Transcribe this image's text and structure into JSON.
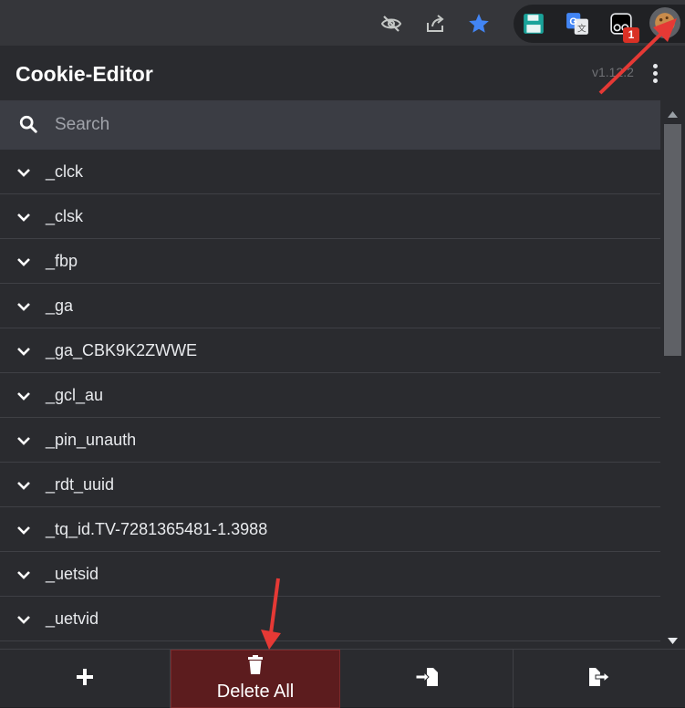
{
  "browser": {
    "toolbar_icons": [
      "eye-slash-icon",
      "share-icon",
      "star-icon"
    ],
    "extensions": [
      "save-extension-icon",
      "google-translate-icon",
      "media-extension-icon",
      "cookie-editor-extension-icon"
    ],
    "badge_count": "1",
    "accent": "#4285f4"
  },
  "header": {
    "title": "Cookie-Editor",
    "version": "v1.12.2"
  },
  "search": {
    "placeholder": "Search",
    "value": ""
  },
  "cookies": [
    {
      "name": "_clck"
    },
    {
      "name": "_clsk"
    },
    {
      "name": "_fbp"
    },
    {
      "name": "_ga"
    },
    {
      "name": "_ga_CBK9K2ZWWE"
    },
    {
      "name": "_gcl_au"
    },
    {
      "name": "_pin_unauth"
    },
    {
      "name": "_rdt_uuid"
    },
    {
      "name": "_tq_id.TV-7281365481-1.3988"
    },
    {
      "name": "_uetsid"
    },
    {
      "name": "_uetvid"
    }
  ],
  "footer": {
    "delete_all_label": "Delete All",
    "buttons": [
      "add-icon",
      "trash-icon",
      "import-icon",
      "export-icon"
    ],
    "delete_color": "#5c1c1e"
  },
  "annotation_color": "#e53935"
}
